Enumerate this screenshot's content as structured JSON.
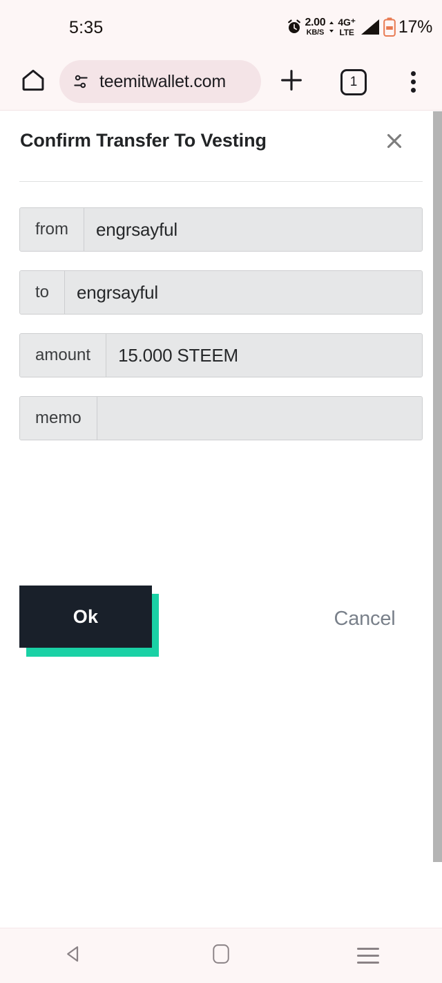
{
  "status_bar": {
    "time": "5:35",
    "alarm_icon": "alarm-clock-icon",
    "network_speed_value": "2.00",
    "network_speed_unit": "KB/S",
    "data_arrows_icon": "data-transfer-arrows-icon",
    "network_type": "4G⁺",
    "network_tech": "LTE",
    "signal_icon": "signal-bars-icon",
    "battery_icon": "battery-low-icon",
    "battery_percent": "17%"
  },
  "browser": {
    "home_icon": "home-icon",
    "site_settings_icon": "tune-sliders-icon",
    "url": "teemitwallet.com",
    "new_tab_icon": "plus-icon",
    "tab_count": "1",
    "menu_icon": "three-dots-vertical-icon"
  },
  "dialog": {
    "title": "Confirm Transfer To Vesting",
    "close_icon": "close-x-icon",
    "fields": [
      {
        "label": "from",
        "value": "engrsayful"
      },
      {
        "label": "to",
        "value": "engrsayful"
      },
      {
        "label": "amount",
        "value": "15.000 STEEM"
      },
      {
        "label": "memo",
        "value": ""
      }
    ],
    "ok_label": "Ok",
    "cancel_label": "Cancel"
  },
  "colors": {
    "chrome_background": "#fdf6f6",
    "url_pill": "#f4e4e7",
    "ok_button": "#19202a",
    "ok_button_shadow": "#1ad1a5",
    "cancel_text": "#79808a",
    "field_background": "#e8e9ea",
    "field_border": "#cdced0",
    "scrollbar": "#b4b4b4"
  },
  "nav_bar": {
    "back_icon": "back-triangle-icon",
    "home_icon": "home-square-icon",
    "recents_icon": "recents-lines-icon"
  }
}
